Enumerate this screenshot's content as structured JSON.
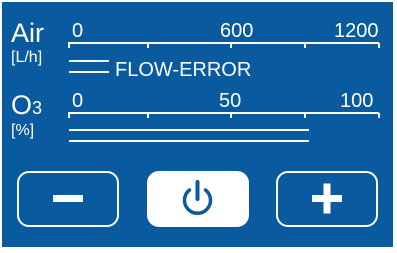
{
  "air": {
    "label": "Air",
    "unit": "[L/h]",
    "scale_ticks": [
      "0",
      "600",
      "1200"
    ],
    "status": "FLOW-ERROR"
  },
  "ozone": {
    "label": "O",
    "label_sub": "3",
    "unit": "[%]",
    "scale_ticks": [
      "0",
      "50",
      "100"
    ],
    "level_fraction": 0
  },
  "controls": {
    "decrease_icon": "minus-icon",
    "power_icon": "power-icon",
    "increase_icon": "plus-icon"
  },
  "colors": {
    "background": "#0a5aa0",
    "foreground": "#ffffff"
  }
}
